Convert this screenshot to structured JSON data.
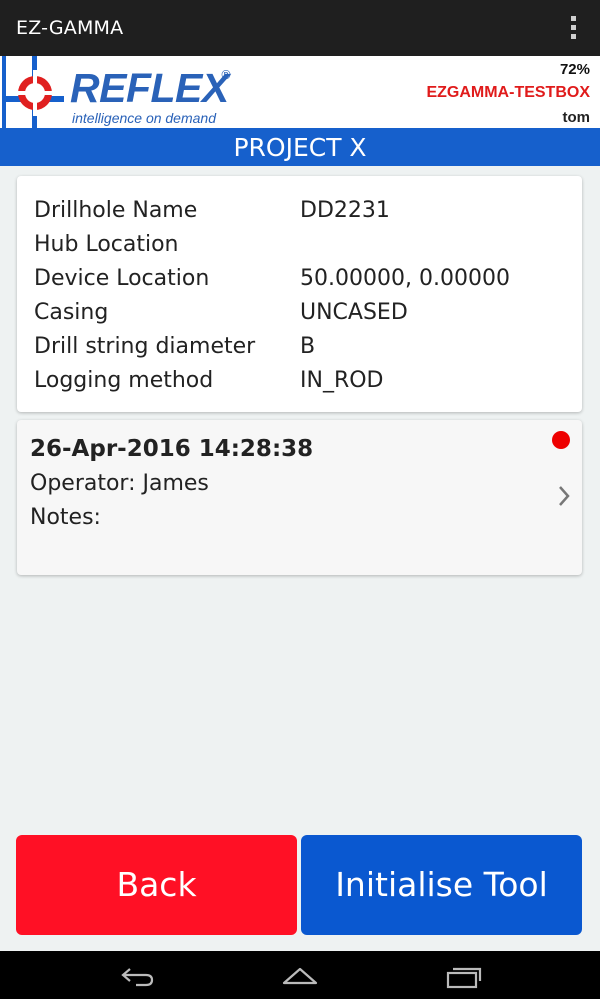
{
  "app_bar": {
    "title": "EZ-GAMMA",
    "overflow_icon": "more-vert-icon"
  },
  "header": {
    "logo_text": "REFLEX",
    "logo_registered": "®",
    "logo_tagline": "intelligence on demand",
    "battery": "72%",
    "device_name": "EZGAMMA-TESTBOX",
    "user": "tom"
  },
  "project": {
    "title": "PROJECT X"
  },
  "details": [
    {
      "label": "Drillhole Name",
      "value": "DD2231"
    },
    {
      "label": "Hub Location",
      "value": ""
    },
    {
      "label": "Device Location",
      "value": "50.00000, 0.00000"
    },
    {
      "label": "Casing",
      "value": "UNCASED"
    },
    {
      "label": "Drill string diameter",
      "value": "B"
    },
    {
      "label": "Logging method",
      "value": "IN_ROD"
    }
  ],
  "session": {
    "datetime": "26-Apr-2016 14:28:38",
    "operator": "Operator: James",
    "notes": "Notes:",
    "status_color": "#ee0000"
  },
  "buttons": {
    "back": "Back",
    "initialise": "Initialise Tool"
  },
  "nav": {
    "back_icon": "nav-back-icon",
    "home_icon": "nav-home-icon",
    "recents_icon": "nav-recents-icon"
  },
  "colors": {
    "primary": "#1660cc",
    "danger": "#ff1025",
    "accent_red": "#e01b1b"
  }
}
